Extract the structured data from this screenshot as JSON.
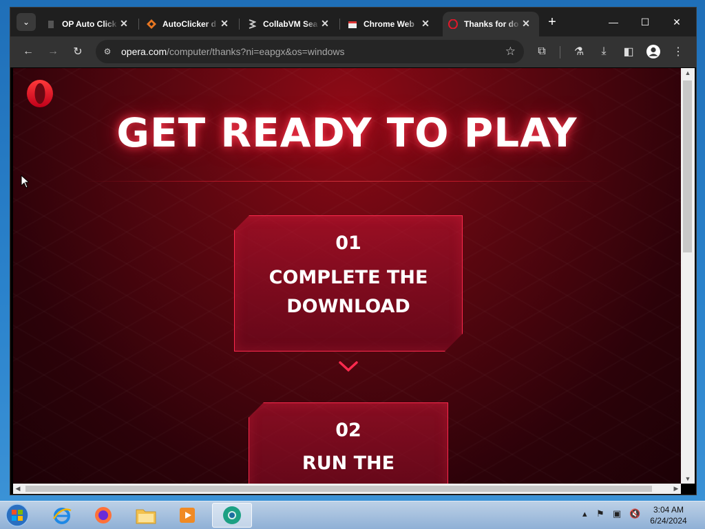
{
  "browser": {
    "tabs": [
      {
        "label": "OP Auto Click",
        "icon": "generic-doc-icon"
      },
      {
        "label": "AutoClicker d",
        "icon": "autoclicker-icon"
      },
      {
        "label": "CollabVM Sea",
        "icon": "collabvm-icon"
      },
      {
        "label": "Chrome Web",
        "icon": "chrome-web-store-icon"
      },
      {
        "label": "Thanks for do",
        "icon": "opera-icon",
        "active": true
      }
    ],
    "url_host": "opera.com",
    "url_path": "/computer/thanks?ni=eapgx&os=windows"
  },
  "page": {
    "headline": "GET READY TO PLAY",
    "steps": [
      {
        "number": "01",
        "text_line1": "COMPLETE THE",
        "text_line2": "DOWNLOAD"
      },
      {
        "number": "02",
        "text_line1": "RUN THE",
        "text_line2": ""
      }
    ],
    "accent_color": "#ff2a4e"
  },
  "taskbar": {
    "apps": [
      "internet-explorer-icon",
      "firefox-icon",
      "file-explorer-icon",
      "media-player-icon",
      "chrome-icon"
    ],
    "time": "3:04 AM",
    "date": "6/24/2024"
  }
}
